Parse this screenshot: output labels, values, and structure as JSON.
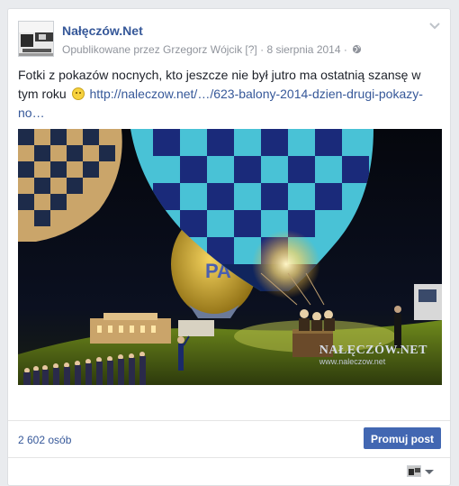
{
  "post": {
    "page_name": "Nałęczów.Net",
    "published_by": "Opublikowane przez Grzegorz Wójcik",
    "edit_marker": "[?]",
    "separator": "·",
    "date": "8 sierpnia 2014",
    "separator2": "·",
    "privacy_icon": "globe-icon",
    "text": "Fotki z pokazów nocnych, kto jeszcze nie był jutro ma ostatnią szansę w tym roku",
    "emoji": "smile-emoji",
    "link_text": "http://naleczow.net/…/623-balony-2014-dzien-drugi-pokazy-no…"
  },
  "photo": {
    "watermark_title": "NAŁĘCZÓW.NET",
    "watermark_url": "www.naleczow.net"
  },
  "footer": {
    "reach": "2 602 osób",
    "promote_label": "Promuj post"
  },
  "colors": {
    "brand_link": "#365899",
    "promote_button": "#4267b2",
    "meta_text": "#90949c"
  }
}
